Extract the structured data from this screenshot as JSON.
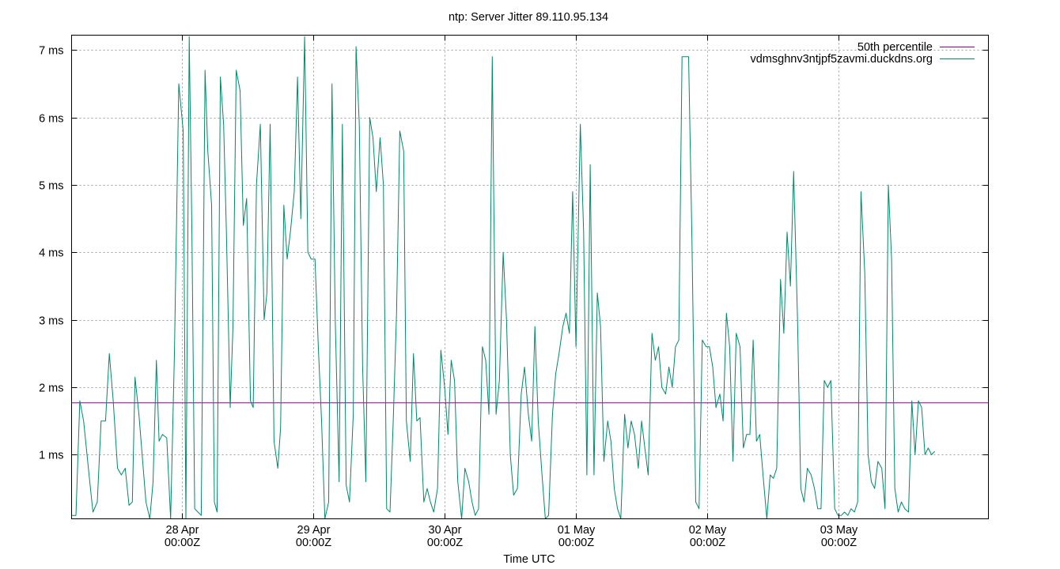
{
  "chart_data": {
    "type": "line",
    "title": "ntp: Server Jitter 89.110.95.134",
    "xlabel": "Time UTC",
    "ylabel": "",
    "x_unit": "hours since first tick (28 Apr 00:00Z)",
    "xlim": [
      -20.2,
      147.4
    ],
    "ylim": [
      0.05,
      7.22
    ],
    "y_ticks": [
      {
        "value": 1,
        "label": "1 ms"
      },
      {
        "value": 2,
        "label": "2 ms"
      },
      {
        "value": 3,
        "label": "3 ms"
      },
      {
        "value": 4,
        "label": "4 ms"
      },
      {
        "value": 5,
        "label": "5 ms"
      },
      {
        "value": 6,
        "label": "6 ms"
      },
      {
        "value": 7,
        "label": "7 ms"
      }
    ],
    "x_ticks": [
      {
        "value": 0,
        "date": "28 Apr",
        "time": "00:00Z"
      },
      {
        "value": 24,
        "date": "29 Apr",
        "time": "00:00Z"
      },
      {
        "value": 48,
        "date": "30 Apr",
        "time": "00:00Z"
      },
      {
        "value": 72,
        "date": "01 May",
        "time": "00:00Z"
      },
      {
        "value": 96,
        "date": "02 May",
        "time": "00:00Z"
      },
      {
        "value": 120,
        "date": "03 May",
        "time": "00:00Z"
      }
    ],
    "grid": true,
    "legend_position": "top-right",
    "series": [
      {
        "name": "50th percentile",
        "color": "#8b0090",
        "kind": "constant",
        "value": 1.77
      },
      {
        "name": "vdmsghnv3ntjpf5zavmi.duckdns.org",
        "color": "#00896a",
        "points": [
          [
            -20.2,
            0.1
          ],
          [
            -19.4,
            0.1
          ],
          [
            -18.7,
            1.8
          ],
          [
            -18.0,
            1.5
          ],
          [
            -17.0,
            0.7
          ],
          [
            -16.3,
            0.15
          ],
          [
            -15.5,
            0.3
          ],
          [
            -14.8,
            1.5
          ],
          [
            -14.0,
            1.5
          ],
          [
            -13.3,
            2.5
          ],
          [
            -12.6,
            1.8
          ],
          [
            -11.8,
            0.8
          ],
          [
            -11.1,
            0.7
          ],
          [
            -10.4,
            0.8
          ],
          [
            -9.7,
            0.25
          ],
          [
            -9.1,
            0.3
          ],
          [
            -8.6,
            2.15
          ],
          [
            -7.9,
            1.6
          ],
          [
            -7.3,
            1.0
          ],
          [
            -6.6,
            0.3
          ],
          [
            -5.9,
            0.05
          ],
          [
            -5.3,
            0.6
          ],
          [
            -4.7,
            2.4
          ],
          [
            -4.2,
            1.2
          ],
          [
            -3.6,
            1.3
          ],
          [
            -2.8,
            1.25
          ],
          [
            -2.1,
            0.05
          ],
          [
            -1.4,
            2.5
          ],
          [
            -0.6,
            6.5
          ],
          [
            0.2,
            5.8
          ],
          [
            0.7,
            0.05
          ],
          [
            1.3,
            7.2
          ],
          [
            1.8,
            4.3
          ],
          [
            2.3,
            0.2
          ],
          [
            2.9,
            0.15
          ],
          [
            3.5,
            0.1
          ],
          [
            4.2,
            6.7
          ],
          [
            4.7,
            5.5
          ],
          [
            5.4,
            4.7
          ],
          [
            5.9,
            0.3
          ],
          [
            6.4,
            0.15
          ],
          [
            7.0,
            6.6
          ],
          [
            7.6,
            5.9
          ],
          [
            8.1,
            4.3
          ],
          [
            8.8,
            1.7
          ],
          [
            9.3,
            2.9
          ],
          [
            9.9,
            6.7
          ],
          [
            10.6,
            6.4
          ],
          [
            11.2,
            4.4
          ],
          [
            11.8,
            4.8
          ],
          [
            12.5,
            1.8
          ],
          [
            13.0,
            1.7
          ],
          [
            13.6,
            5.0
          ],
          [
            14.3,
            5.9
          ],
          [
            15.0,
            3.0
          ],
          [
            15.5,
            3.4
          ],
          [
            16.1,
            5.9
          ],
          [
            16.8,
            1.2
          ],
          [
            17.5,
            0.8
          ],
          [
            18.0,
            1.4
          ],
          [
            18.6,
            4.7
          ],
          [
            19.2,
            3.9
          ],
          [
            19.8,
            4.3
          ],
          [
            20.5,
            4.9
          ],
          [
            21.1,
            6.6
          ],
          [
            21.7,
            4.5
          ],
          [
            22.4,
            7.2
          ],
          [
            23.0,
            4.0
          ],
          [
            23.6,
            3.9
          ],
          [
            24.3,
            3.9
          ],
          [
            24.9,
            2.6
          ],
          [
            25.5,
            1.5
          ],
          [
            26.1,
            0.05
          ],
          [
            26.8,
            0.3
          ],
          [
            27.4,
            6.5
          ],
          [
            28.0,
            3.0
          ],
          [
            28.7,
            0.6
          ],
          [
            29.3,
            5.9
          ],
          [
            30.0,
            0.55
          ],
          [
            30.6,
            0.3
          ],
          [
            31.3,
            1.6
          ],
          [
            31.8,
            7.05
          ],
          [
            32.4,
            5.9
          ],
          [
            33.0,
            2.3
          ],
          [
            33.6,
            0.6
          ],
          [
            34.3,
            6.0
          ],
          [
            34.9,
            5.7
          ],
          [
            35.5,
            4.9
          ],
          [
            36.2,
            5.7
          ],
          [
            36.8,
            5.0
          ],
          [
            37.4,
            0.2
          ],
          [
            38.0,
            0.15
          ],
          [
            38.6,
            1.5
          ],
          [
            39.2,
            3.1
          ],
          [
            39.8,
            5.8
          ],
          [
            40.5,
            5.5
          ],
          [
            41.0,
            1.5
          ],
          [
            41.7,
            0.9
          ],
          [
            42.3,
            2.5
          ],
          [
            42.9,
            1.5
          ],
          [
            43.5,
            1.55
          ],
          [
            44.2,
            0.3
          ],
          [
            44.8,
            0.5
          ],
          [
            45.4,
            0.3
          ],
          [
            46.0,
            0.15
          ],
          [
            46.7,
            0.5
          ],
          [
            47.3,
            2.55
          ],
          [
            48.0,
            2.0
          ],
          [
            48.6,
            1.3
          ],
          [
            49.2,
            2.4
          ],
          [
            49.8,
            2.1
          ],
          [
            50.4,
            0.6
          ],
          [
            51.1,
            0.05
          ],
          [
            51.7,
            0.8
          ],
          [
            52.4,
            0.6
          ],
          [
            53.0,
            0.3
          ],
          [
            53.6,
            0.1
          ],
          [
            54.2,
            0.2
          ],
          [
            54.9,
            2.6
          ],
          [
            55.5,
            2.4
          ],
          [
            56.1,
            1.6
          ],
          [
            56.7,
            6.9
          ],
          [
            57.4,
            1.6
          ],
          [
            58.0,
            2.1
          ],
          [
            58.7,
            4.0
          ],
          [
            59.3,
            3.0
          ],
          [
            60.0,
            1.0
          ],
          [
            60.6,
            0.4
          ],
          [
            61.3,
            0.5
          ],
          [
            62.0,
            1.9
          ],
          [
            62.6,
            2.3
          ],
          [
            63.3,
            1.6
          ],
          [
            63.9,
            1.2
          ],
          [
            64.5,
            2.9
          ],
          [
            65.1,
            1.5
          ],
          [
            65.8,
            0.7
          ],
          [
            66.4,
            0.05
          ],
          [
            67.0,
            0.1
          ],
          [
            67.7,
            1.6
          ],
          [
            68.3,
            2.2
          ],
          [
            68.9,
            2.5
          ],
          [
            69.6,
            2.9
          ],
          [
            70.2,
            3.1
          ],
          [
            70.8,
            2.8
          ],
          [
            71.4,
            4.9
          ],
          [
            72.0,
            2.6
          ],
          [
            72.8,
            5.9
          ],
          [
            73.4,
            4.3
          ],
          [
            74.0,
            0.7
          ],
          [
            74.6,
            5.3
          ],
          [
            75.3,
            0.7
          ],
          [
            75.9,
            3.4
          ],
          [
            76.5,
            2.9
          ],
          [
            77.1,
            0.9
          ],
          [
            77.8,
            1.5
          ],
          [
            78.4,
            1.2
          ],
          [
            79.0,
            0.5
          ],
          [
            79.6,
            0.2
          ],
          [
            80.2,
            0.05
          ],
          [
            80.9,
            1.6
          ],
          [
            81.5,
            1.1
          ],
          [
            82.1,
            1.5
          ],
          [
            82.7,
            1.3
          ],
          [
            83.4,
            0.8
          ],
          [
            84.0,
            1.5
          ],
          [
            84.6,
            1.1
          ],
          [
            85.2,
            0.7
          ],
          [
            85.9,
            2.8
          ],
          [
            86.5,
            2.4
          ],
          [
            87.1,
            2.6
          ],
          [
            87.7,
            2.0
          ],
          [
            88.4,
            1.9
          ],
          [
            89.0,
            2.3
          ],
          [
            89.6,
            2.0
          ],
          [
            90.2,
            2.6
          ],
          [
            90.8,
            2.7
          ],
          [
            91.4,
            6.9
          ],
          [
            92.0,
            6.9
          ],
          [
            92.6,
            6.9
          ],
          [
            93.2,
            4.2
          ],
          [
            93.9,
            0.3
          ],
          [
            94.5,
            0.2
          ],
          [
            95.1,
            2.7
          ],
          [
            95.8,
            2.6
          ],
          [
            96.4,
            2.6
          ],
          [
            97.0,
            2.3
          ],
          [
            97.6,
            1.7
          ],
          [
            98.3,
            1.9
          ],
          [
            98.9,
            1.5
          ],
          [
            99.5,
            3.1
          ],
          [
            100.1,
            2.6
          ],
          [
            100.7,
            0.9
          ],
          [
            101.3,
            2.8
          ],
          [
            102.0,
            2.6
          ],
          [
            102.6,
            1.1
          ],
          [
            103.2,
            1.3
          ],
          [
            103.8,
            1.3
          ],
          [
            104.4,
            2.7
          ],
          [
            105.0,
            1.2
          ],
          [
            105.6,
            1.3
          ],
          [
            106.3,
            0.6
          ],
          [
            106.9,
            0.05
          ],
          [
            107.5,
            0.7
          ],
          [
            108.1,
            0.65
          ],
          [
            108.7,
            0.8
          ],
          [
            109.4,
            3.6
          ],
          [
            110.0,
            2.8
          ],
          [
            110.6,
            4.3
          ],
          [
            111.2,
            3.5
          ],
          [
            111.8,
            5.2
          ],
          [
            112.5,
            3.0
          ],
          [
            113.1,
            0.5
          ],
          [
            113.7,
            0.3
          ],
          [
            114.3,
            0.8
          ],
          [
            115.0,
            0.7
          ],
          [
            115.6,
            0.5
          ],
          [
            116.2,
            0.2
          ],
          [
            116.8,
            0.2
          ],
          [
            117.4,
            2.1
          ],
          [
            118.0,
            2.0
          ],
          [
            118.6,
            2.1
          ],
          [
            119.3,
            0.2
          ],
          [
            119.9,
            0.1
          ],
          [
            120.5,
            0.1
          ],
          [
            121.1,
            0.15
          ],
          [
            121.7,
            0.1
          ],
          [
            122.3,
            0.2
          ],
          [
            122.9,
            0.15
          ],
          [
            123.5,
            0.3
          ],
          [
            124.1,
            4.9
          ],
          [
            124.8,
            3.7
          ],
          [
            125.4,
            1.0
          ],
          [
            126.0,
            0.6
          ],
          [
            126.6,
            0.5
          ],
          [
            127.2,
            0.9
          ],
          [
            127.9,
            0.8
          ],
          [
            128.5,
            0.2
          ],
          [
            129.1,
            5.0
          ],
          [
            129.7,
            3.9
          ],
          [
            130.3,
            0.5
          ],
          [
            130.9,
            0.15
          ],
          [
            131.5,
            0.3
          ],
          [
            132.1,
            0.2
          ],
          [
            132.8,
            0.15
          ],
          [
            133.4,
            1.8
          ],
          [
            134.0,
            1.0
          ],
          [
            134.6,
            1.8
          ],
          [
            135.2,
            1.7
          ],
          [
            135.8,
            1.0
          ],
          [
            136.4,
            1.1
          ],
          [
            137.0,
            1.0
          ],
          [
            137.6,
            1.05
          ]
        ]
      }
    ]
  }
}
